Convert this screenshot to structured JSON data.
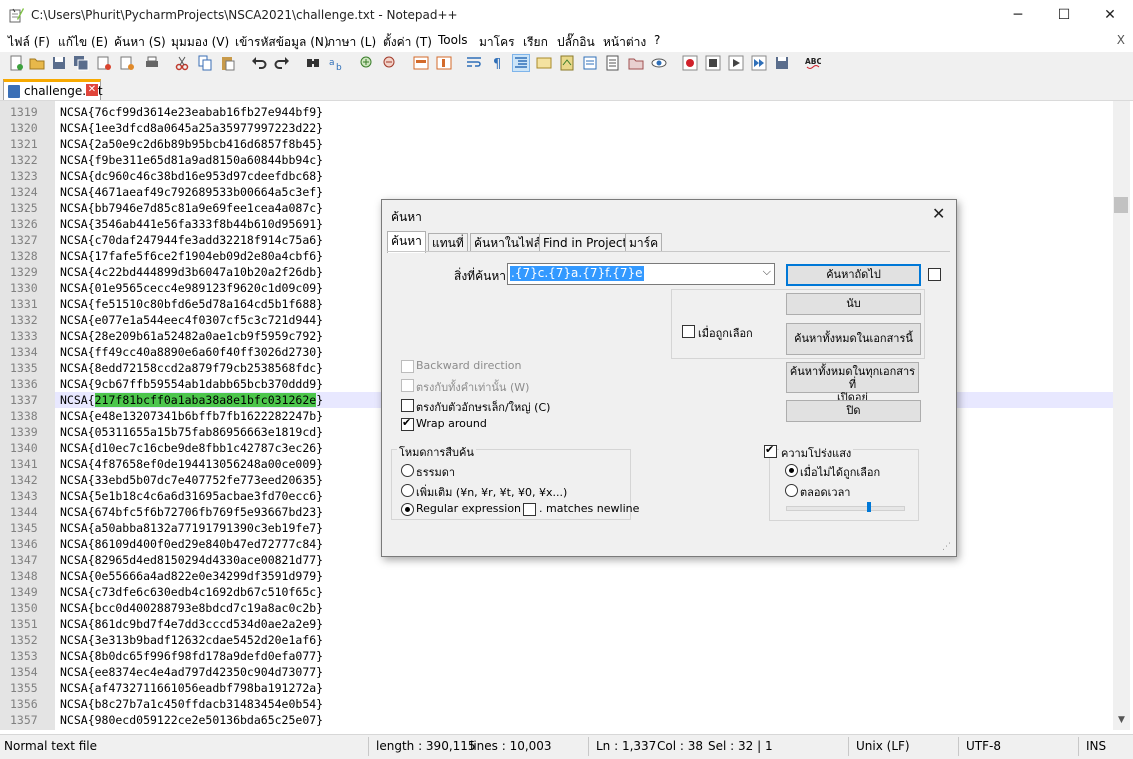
{
  "window": {
    "title": "C:\\Users\\Phurit\\PycharmProjects\\NSCA2021\\challenge.txt - Notepad++",
    "minimize": "─",
    "maximize": "☐",
    "close": "✕"
  },
  "menu": {
    "items": [
      "ไฟล์ (F)",
      "แก้ไข (E)",
      "ค้นหา (S)",
      "มุมมอง (V)",
      "เข้ารหัสข้อมูล (N)",
      "ภาษา (L)",
      "ตั้งค่า (T)",
      "Tools",
      "มาโคร",
      "เรียก",
      "ปลั๊กอิน",
      "หน้าต่าง",
      "?"
    ],
    "close": "X"
  },
  "tab": {
    "label": "challenge.txt",
    "close": "✕"
  },
  "editor": {
    "lines": [
      {
        "n": "1319",
        "t": "NCSA{76cf99d3614e23eabab16fb27e944bf9}"
      },
      {
        "n": "1320",
        "t": "NCSA{1ee3dfcd8a0645a25a35977997223d22}"
      },
      {
        "n": "1321",
        "t": "NCSA{2a50e9c2d6b89b95bcb416d6857f8b45}"
      },
      {
        "n": "1322",
        "t": "NCSA{f9be311e65d81a9ad8150a60844bb94c}"
      },
      {
        "n": "1323",
        "t": "NCSA{dc960c46c38bd16e953d97cdeefdbc68}"
      },
      {
        "n": "1324",
        "t": "NCSA{4671aeaf49c792689533b00664a5c3ef}"
      },
      {
        "n": "1325",
        "t": "NCSA{bb7946e7d85c81a9e69fee1cea4a087c}"
      },
      {
        "n": "1326",
        "t": "NCSA{3546ab441e56fa333f8b44b610d95691}"
      },
      {
        "n": "1327",
        "t": "NCSA{c70daf247944fe3add32218f914c75a6}"
      },
      {
        "n": "1328",
        "t": "NCSA{17fafe5f6ce2f1904eb09d2e80a4cbf6}"
      },
      {
        "n": "1329",
        "t": "NCSA{4c22bd444899d3b6047a10b20a2f26db}"
      },
      {
        "n": "1330",
        "t": "NCSA{01e9565cecc4e989123f9620c1d09c09}"
      },
      {
        "n": "1331",
        "t": "NCSA{fe51510c80bfd6e5d78a164cd5b1f688}"
      },
      {
        "n": "1332",
        "t": "NCSA{e077e1a544eec4f0307cf5c3c721d944}"
      },
      {
        "n": "1333",
        "t": "NCSA{28e209b61a52482a0ae1cb9f5959c792}"
      },
      {
        "n": "1334",
        "t": "NCSA{ff49cc40a8890e6a60f40ff3026d2730}"
      },
      {
        "n": "1335",
        "t": "NCSA{8edd72158ccd2a879f79cb2538568fdc}"
      },
      {
        "n": "1336",
        "t": "NCSA{9cb67ffb59554ab1dabb65bcb370ddd9}"
      },
      {
        "n": "1337",
        "t": "NCSA{",
        "hl": "217f81bcff0a1aba38a8e1bfc031262e",
        "after": "}"
      },
      {
        "n": "1338",
        "t": "NCSA{e48e13207341b6bffb7fb1622282247b}"
      },
      {
        "n": "1339",
        "t": "NCSA{05311655a15b75fab86956663e1819cd}"
      },
      {
        "n": "1340",
        "t": "NCSA{d10ec7c16cbe9de8fbb1c42787c3ec26}"
      },
      {
        "n": "1341",
        "t": "NCSA{4f87658ef0de194413056248a00ce009}"
      },
      {
        "n": "1342",
        "t": "NCSA{33ebd5b07dc7e407752fe773eed20635}"
      },
      {
        "n": "1343",
        "t": "NCSA{5e1b18c4c6a6d31695acbae3fd70ecc6}"
      },
      {
        "n": "1344",
        "t": "NCSA{674bfc5f6b72706fb769f5e93667bd23}"
      },
      {
        "n": "1345",
        "t": "NCSA{a50abba8132a77191791390c3eb19fe7}"
      },
      {
        "n": "1346",
        "t": "NCSA{86109d400f0ed29e840b47ed72777c84}"
      },
      {
        "n": "1347",
        "t": "NCSA{82965d4ed8150294d4330ace00821d77}"
      },
      {
        "n": "1348",
        "t": "NCSA{0e55666a4ad822e0e34299df3591d979}"
      },
      {
        "n": "1349",
        "t": "NCSA{c73dfe6c630edb4c1692db67c510f65c}"
      },
      {
        "n": "1350",
        "t": "NCSA{bcc0d400288793e8bdcd7c19a8ac0c2b}"
      },
      {
        "n": "1351",
        "t": "NCSA{861dc9bd7f4e7dd3cccd534d0ae2a2e9}"
      },
      {
        "n": "1352",
        "t": "NCSA{3e313b9badf12632cdae5452d20e1af6}"
      },
      {
        "n": "1353",
        "t": "NCSA{8b0dc65f996f98fd178a9defd0efa077}"
      },
      {
        "n": "1354",
        "t": "NCSA{ee8374ec4e4ad797d42350c904d73077}"
      },
      {
        "n": "1355",
        "t": "NCSA{af4732711661056eadbf798ba191272a}"
      },
      {
        "n": "1356",
        "t": "NCSA{b8c27b7a1c450ffdacb31483454e0b54}"
      },
      {
        "n": "1357",
        "t": "NCSA{980ecd059122ce2e50136bda65c25e07}"
      }
    ]
  },
  "find_dialog": {
    "title": "ค้นหา",
    "close": "✕",
    "tabs": [
      "ค้นหา",
      "แทนที่",
      "ค้นหาในไฟล์",
      "Find in Projects",
      "มาร์ค"
    ],
    "find_label": "สิ่งที่ค้นหา :",
    "find_value": ".{7}c.{7}a.{7}f.{7}e",
    "buttons": {
      "find_next": "ค้นหาถัดไป",
      "count": "นับ",
      "find_all_current": "ค้นหาทั้งหมดในเอกสารนี้",
      "find_all_open_1": "ค้นหาทั้งหมดในทุกเอกสารที่",
      "find_all_open_2": "เปิดอยู่",
      "close": "ปิด"
    },
    "in_selection": "เมื่อถูกเลือก",
    "options": {
      "backward": "Backward direction",
      "whole_word": "ตรงกับทั้งคำเท่านั้น (W)",
      "match_case": "ตรงกับตัวอักษรเล็ก/ใหญ่ (C)",
      "wrap": "Wrap around"
    },
    "search_mode": {
      "title": "โหมดการสืบค้น",
      "normal": "ธรรมดา",
      "extended": "เพิ่มเติม (¥n, ¥r, ¥t, ¥0, ¥x...)",
      "regex": "Regular expression",
      "dot_newline": ". matches newline"
    },
    "transparency": {
      "title": "ความโปร่งแสง",
      "on_losing_focus": "เมื่อไม่ได้ถูกเลือก",
      "always": "ตลอดเวลา",
      "level": 0.71
    }
  },
  "status": {
    "type": "Normal text file",
    "length": "length : 390,115",
    "lines": "lines : 10,003",
    "ln": "Ln : 1,337",
    "col": "Col : 38",
    "sel": "Sel : 32 | 1",
    "eol": "Unix (LF)",
    "enc": "UTF-8",
    "ins": "INS"
  },
  "colors": {
    "match_highlight": "#4cc64c",
    "current_line": "#e8e8ff",
    "selection": "#3399ff"
  }
}
